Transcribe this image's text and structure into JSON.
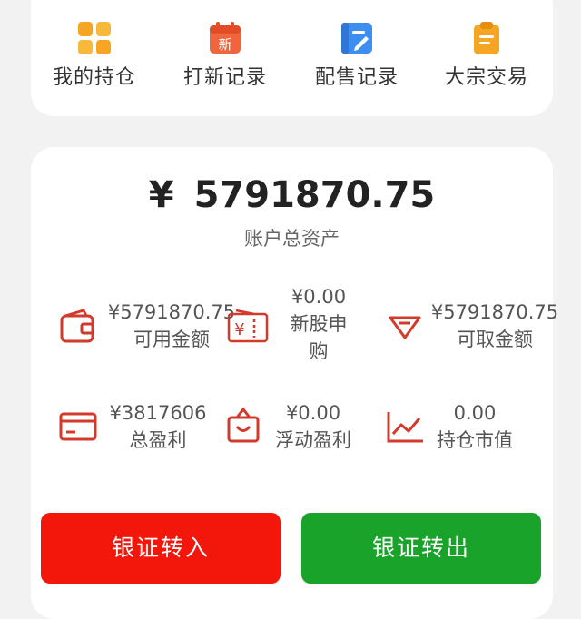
{
  "shortcuts": [
    {
      "label": "我的持仓",
      "icon": "grid-icon"
    },
    {
      "label": "打新记录",
      "icon": "calendar-new-icon",
      "badge": "新"
    },
    {
      "label": "配售记录",
      "icon": "edit-note-icon"
    },
    {
      "label": "大宗交易",
      "icon": "clipboard-icon"
    }
  ],
  "account": {
    "currency": "¥",
    "total_amount": "5791870.75",
    "total_label": "账户总资产"
  },
  "stats": [
    {
      "value": "¥5791870.75",
      "label": "可用金额",
      "icon": "wallet-icon"
    },
    {
      "value": "¥0.00",
      "label": "新股申购",
      "icon": "ticket-icon"
    },
    {
      "value": "¥5791870.75",
      "label": "可取金额",
      "icon": "diamond-icon"
    },
    {
      "value": "¥3817606",
      "label": "总盈利",
      "icon": "card-icon"
    },
    {
      "value": "¥0.00",
      "label": "浮动盈利",
      "icon": "bag-icon"
    },
    {
      "value": "0.00",
      "label": "持仓市值",
      "icon": "trend-chart-icon"
    }
  ],
  "buttons": {
    "transfer_in": "银证转入",
    "transfer_out": "银证转出"
  },
  "colors": {
    "accent_red": "#f2160b",
    "accent_green": "#19a32a",
    "icon_red": "#d23a2c"
  }
}
